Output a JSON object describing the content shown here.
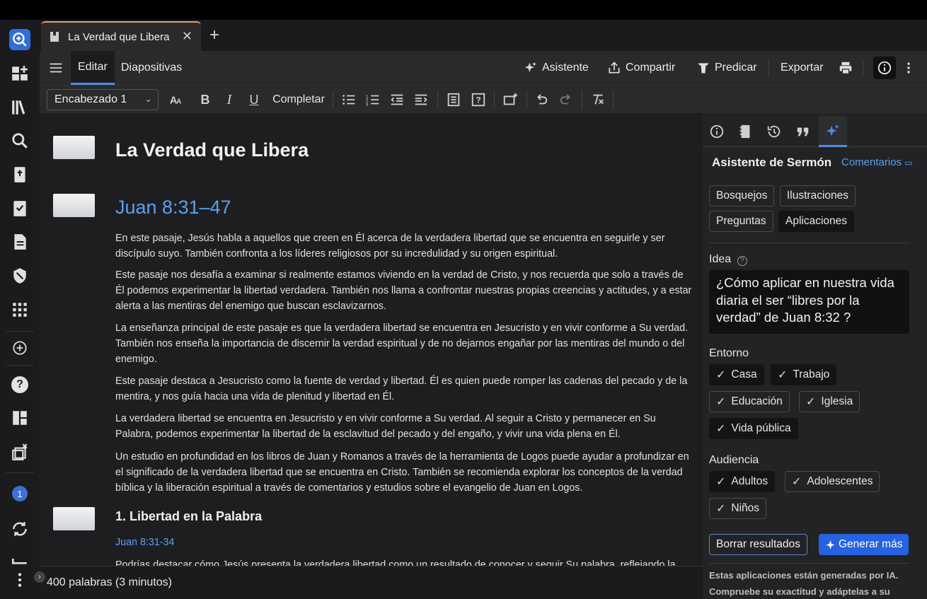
{
  "tab": {
    "title": "La Verdad que Libera",
    "close": "✕",
    "new": "+"
  },
  "toolbar": {
    "editar": "Editar",
    "diapositivas": "Diapositivas",
    "asistente": "Asistente",
    "compartir": "Compartir",
    "predicar": "Predicar",
    "exportar": "Exportar"
  },
  "format": {
    "style_value": "Encabezado 1",
    "completar": "Completar"
  },
  "document": {
    "title": "La Verdad que Libera",
    "reference": "Juan 8:31–47",
    "paragraphs": [
      "En este pasaje, Jesús habla a aquellos que creen en Él acerca de la verdadera libertad que se encuentra en seguirle y ser discípulo suyo. También confronta a los líderes religiosos por su incredulidad y su origen espiritual.",
      "Este pasaje nos desafía a examinar si realmente estamos viviendo en la verdad de Cristo, y nos recuerda que solo a través de Él podemos experimentar la libertad verdadera. También nos llama a confrontar nuestras propias creencias y actitudes, y a estar alerta a las mentiras del enemigo que buscan esclavizarnos.",
      "La enseñanza principal de este pasaje es que la verdadera libertad se encuentra en Jesucristo y en vivir conforme a Su verdad. También nos enseña la importancia de discernir la verdad espiritual y de no dejarnos engañar por las mentiras del mundo o del enemigo.",
      "Este pasaje destaca a Jesucristo como la fuente de verdad y libertad. Él es quien puede romper las cadenas del pecado y de la mentira, y nos guía hacia una vida de plenitud y libertad en Él.",
      "La verdadera libertad se encuentra en Jesucristo y en vivir conforme a Su verdad. Al seguir a Cristo y permanecer en Su Palabra, podemos experimentar la libertad de la esclavitud del pecado y del engaño, y vivir una vida plena en Él.",
      "Un estudio en profundidad en los libros de Juan y Romanos a través de la herramienta de Logos puede ayudar a profundizar en el significado de la verdadera libertad que se encuentra en Cristo. También se recomienda explorar los conceptos de la verdad bíblica y la liberación espiritual a través de comentarios y estudios sobre el evangelio de Juan en Logos."
    ],
    "section_title": "1. Libertad en la Palabra",
    "section_ref": "Juan 8:31-34",
    "cutoff_text": "Podrías destacar cómo Jesús presenta la verdadera libertad como un resultado de conocer y seguir Su palabra, reflejando la"
  },
  "status": {
    "words": "400 palabras (3 minutos)"
  },
  "rail": {
    "badge_count": "1",
    "help": "?"
  },
  "panel": {
    "title": "Asistente de Sermón",
    "comments_link": "Comentarios",
    "categories": [
      "Bosquejos",
      "Ilustraciones",
      "Preguntas",
      "Aplicaciones"
    ],
    "selected_category": "Aplicaciones",
    "idea_label": "Idea",
    "idea_text": "¿Cómo aplicar en nuestra vida diaria el ser “libres por la verdad” de Juan 8:32   ?",
    "entorno_label": "Entorno",
    "entorno": [
      "Casa",
      "Trabajo",
      "Educación",
      "Iglesia",
      "Vida pública"
    ],
    "audiencia_label": "Audiencia",
    "audiencia": [
      "Adultos",
      "Adolescentes",
      "Niños"
    ],
    "clear_button": "Borrar resultados",
    "generate_button": "Generar más",
    "note": "Estas aplicaciones están generadas por IA. Compruebe su exactitud y adáptelas a su"
  },
  "colors": {
    "accent": "#4a8ee8",
    "link": "#5aa0f0",
    "primary_button": "#2563e0",
    "tab_highlight": "#e8a070"
  }
}
